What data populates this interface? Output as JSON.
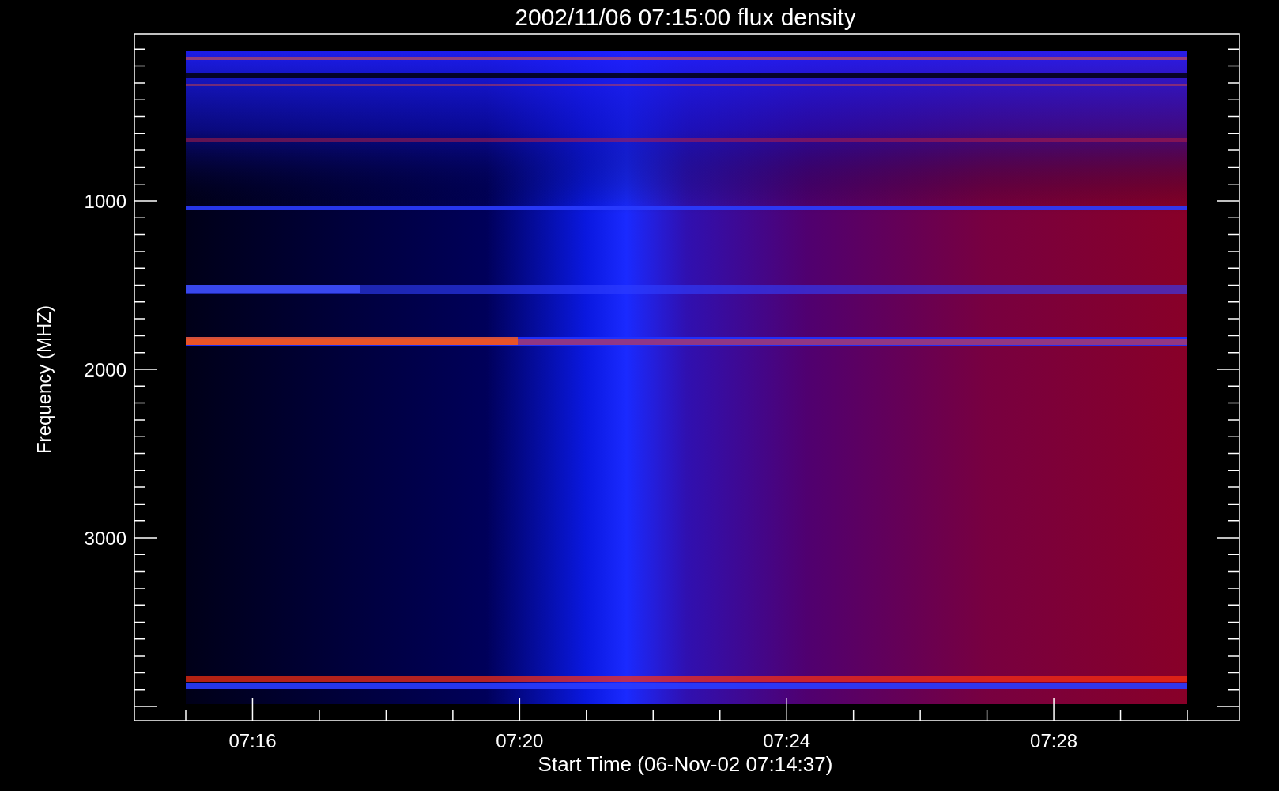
{
  "title": "2002/11/06 07:15:00 flux density",
  "xlabel": "Start Time (06-Nov-02 07:14:37)",
  "ylabel": "Frequency (MHZ)",
  "xticks": [
    "07:16",
    "07:20",
    "07:24",
    "07:28"
  ],
  "yticks": [
    "1000",
    "2000",
    "3000"
  ]
}
